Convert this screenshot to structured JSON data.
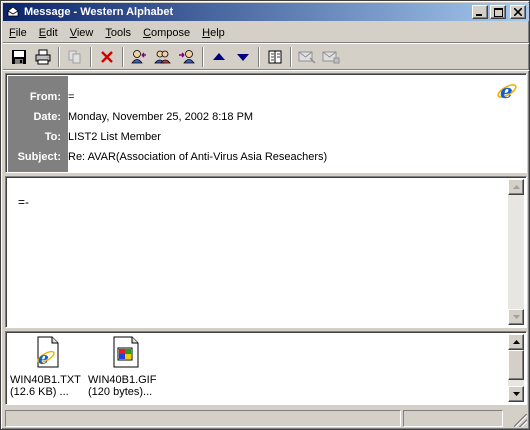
{
  "window": {
    "title": "Message - Western Alphabet"
  },
  "menu": [
    {
      "label": "File",
      "accel": "F",
      "rest": "ile"
    },
    {
      "label": "Edit",
      "accel": "E",
      "rest": "dit"
    },
    {
      "label": "View",
      "accel": "V",
      "rest": "iew"
    },
    {
      "label": "Tools",
      "accel": "T",
      "rest": "ools"
    },
    {
      "label": "Compose",
      "accel": "C",
      "rest": "ompose"
    },
    {
      "label": "Help",
      "accel": "H",
      "rest": "elp"
    }
  ],
  "header": {
    "from_label": "From:",
    "from_value": "=",
    "date_label": "Date:",
    "date_value": "Monday, November 25, 2002 8:18 PM",
    "to_label": "To:",
    "to_value": "LIST2 List Member",
    "subject_label": "Subject:",
    "subject_value": "Re: AVAR(Association of Anti-Virus Asia Reseachers)"
  },
  "body": {
    "text": "=-"
  },
  "attachments": [
    {
      "name": "WIN40B1.TXT",
      "size": "(12.6 KB)   ...",
      "icon": "ie-document-icon"
    },
    {
      "name": "WIN40B1.GIF",
      "size": "(120 bytes)...",
      "icon": "image-file-icon"
    }
  ],
  "colors": {
    "titlebar_start": "#0a246a",
    "titlebar_end": "#a6caf0",
    "header_label_bg": "#808080",
    "chrome": "#d4d0c8"
  }
}
